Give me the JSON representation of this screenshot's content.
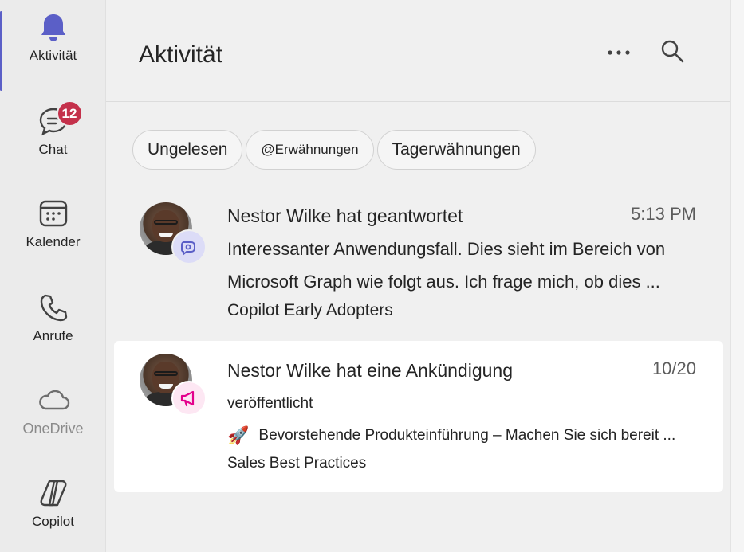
{
  "rail": {
    "items": [
      {
        "label": "Aktivität",
        "icon": "bell-icon",
        "active": true
      },
      {
        "label": "Chat",
        "icon": "chat-icon",
        "badge": "12"
      },
      {
        "label": "Kalender",
        "icon": "calendar-icon"
      },
      {
        "label": "Anrufe",
        "icon": "phone-icon"
      },
      {
        "label": "OneDrive",
        "icon": "cloud-icon",
        "disabled": true
      },
      {
        "label": "Copilot",
        "icon": "copilot-icon"
      }
    ]
  },
  "header": {
    "title": "Aktivität",
    "more_icon": "more-horizontal-icon",
    "search_icon": "search-icon"
  },
  "filters": [
    "Ungelesen",
    "@Erwähnungen",
    "Tagerwähnungen"
  ],
  "feed": [
    {
      "title": "Nestor Wilke hat geantwortet",
      "time": "5:13 PM",
      "preview_line1": "Interessanter Anwendungsfall. Dies sieht im Bereich von",
      "preview_line2": "Microsoft Graph wie folgt aus. Ich frage mich, ob dies ...",
      "channel": "Copilot Early Adopters",
      "type_icon": "reply-icon"
    },
    {
      "title": "Nestor Wilke hat eine Ankündigung",
      "title_line2": "veröffentlicht",
      "time": "10/20",
      "preview": "Bevorstehende Produkteinführung – Machen Sie sich bereit ...",
      "channel": "Sales Best Practices",
      "type_icon": "megaphone-icon",
      "emoji": "🚀"
    }
  ],
  "colors": {
    "accent": "#5b5fc7",
    "badge": "#c4314b",
    "announcement": "#e3008c"
  }
}
